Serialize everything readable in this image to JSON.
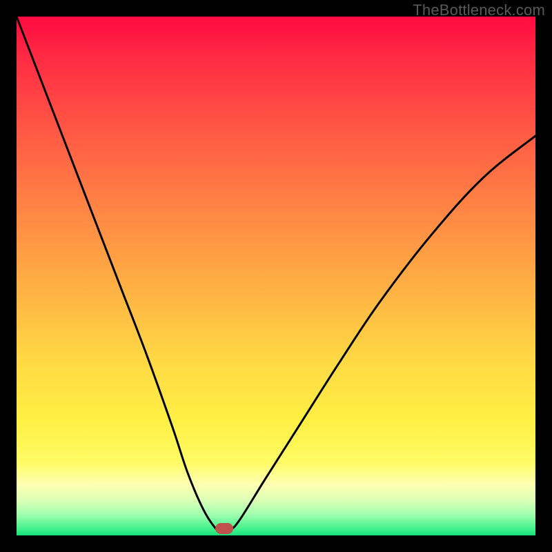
{
  "watermark": "TheBottleneck.com",
  "chart_data": {
    "type": "line",
    "title": "",
    "xlabel": "",
    "ylabel": "",
    "xlim": [
      0,
      100
    ],
    "ylim": [
      0,
      100
    ],
    "grid": false,
    "series": [
      {
        "name": "curve",
        "x": [
          0,
          5,
          10,
          15,
          20,
          25,
          30,
          33,
          36,
          38.5,
          39.5,
          41,
          43,
          48,
          55,
          62,
          70,
          80,
          90,
          100
        ],
        "y": [
          100,
          87,
          74,
          61,
          48,
          35,
          21,
          12,
          5,
          1.2,
          1.0,
          1.0,
          3,
          11,
          22,
          33,
          45,
          58,
          69,
          77
        ]
      }
    ],
    "marker": {
      "x": 40,
      "y": 1.3,
      "color": "#c0524e"
    },
    "gradient_stops": [
      {
        "pos": 0,
        "color": "#ff0a40"
      },
      {
        "pos": 50,
        "color": "#ffc044"
      },
      {
        "pos": 85,
        "color": "#fffc66"
      },
      {
        "pos": 100,
        "color": "#18e07c"
      }
    ]
  }
}
